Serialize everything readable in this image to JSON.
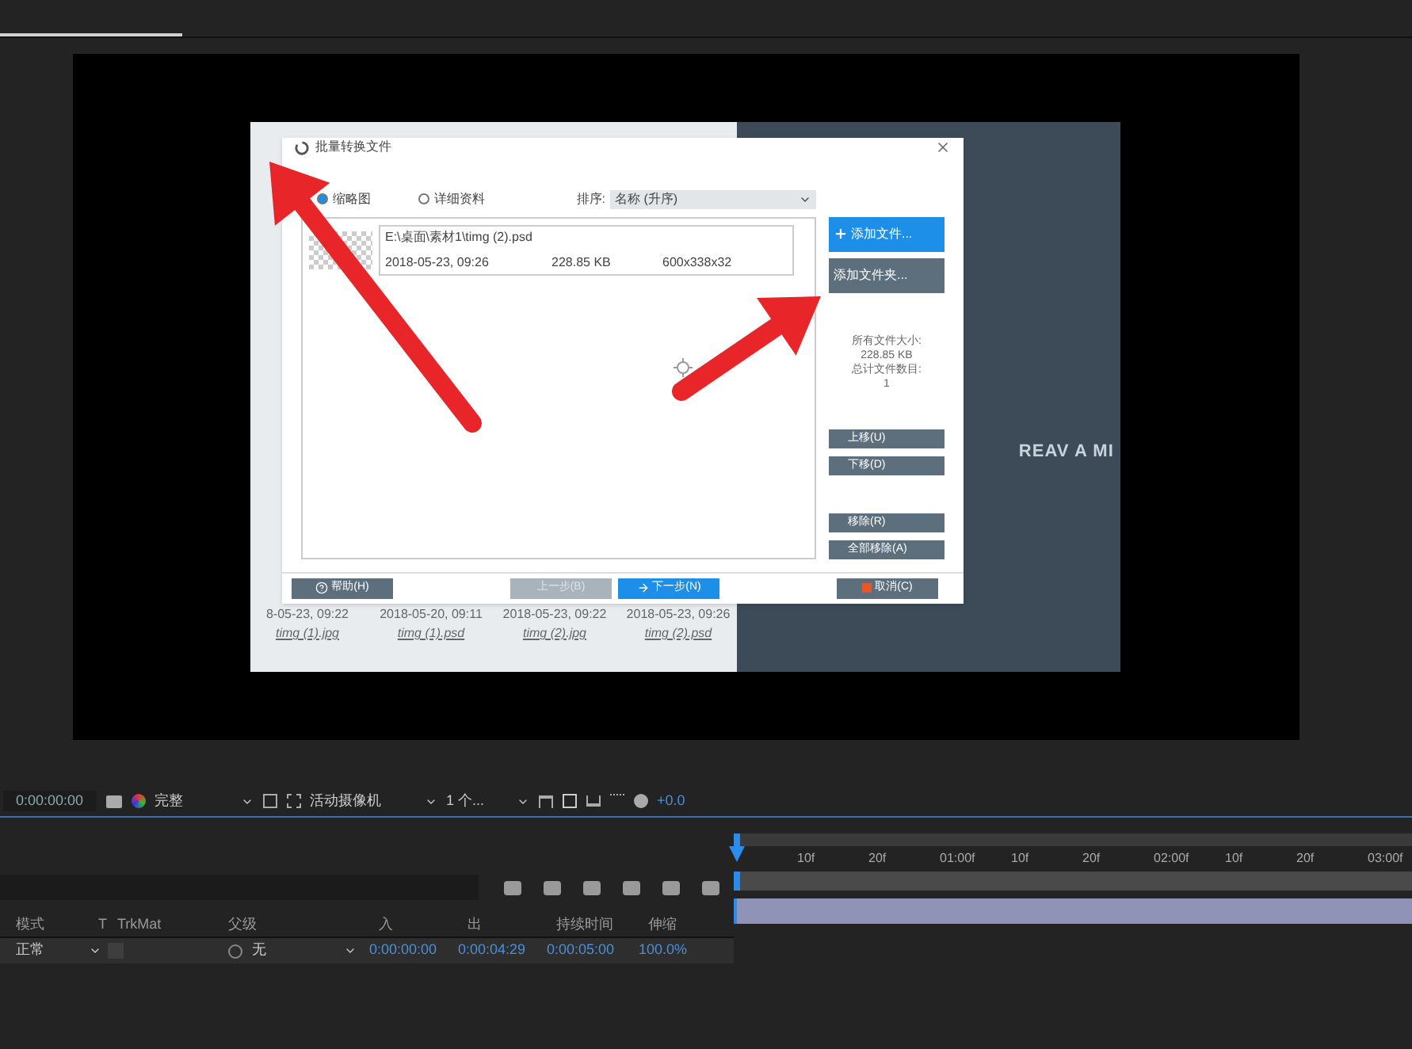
{
  "comp_image": {
    "captions": [
      {
        "date": "8-05-23, 09:22",
        "name": "timg (1).jpg"
      },
      {
        "date": "2018-05-20, 09:11",
        "name": "timg (1).psd"
      },
      {
        "date": "2018-05-23, 09:22",
        "name": "timg (2).jpg"
      },
      {
        "date": "2018-05-23, 09:26",
        "name": "timg (2).psd"
      }
    ],
    "logo_text": "REAV A MI"
  },
  "dialog": {
    "title": "批量转换文件",
    "views": [
      {
        "label": "缩略图",
        "selected": true
      },
      {
        "label": "详细资料",
        "selected": false
      }
    ],
    "sort_label": "排序:",
    "sort_value": "名称 (升序)",
    "file": {
      "path": "E:\\桌面\\素材1\\timg (2).psd",
      "date": "2018-05-23, 09:26",
      "size": "228.85 KB",
      "dims": "600x338x32"
    },
    "side_buttons": [
      {
        "label": "添加文件...",
        "kind": "primary"
      },
      {
        "label": "添加文件夹...",
        "kind": "secondary"
      }
    ],
    "summary": [
      "所有文件大小:",
      "228.85 KB",
      "总计文件数目:",
      "1"
    ],
    "move_buttons": [
      "上移(U)",
      "下移(D)"
    ],
    "remove_buttons": [
      "移除(R)",
      "全部移除(A)"
    ],
    "footer": [
      {
        "label": "帮助(H)",
        "kind": "help"
      },
      {
        "label": "上一步(B)",
        "kind": "disabled"
      },
      {
        "label": "下一步(N)",
        "kind": "primary"
      },
      {
        "label": "取消(C)",
        "kind": "cancel"
      }
    ]
  },
  "viewer_toolbar": {
    "timecode": "0:00:00:00",
    "resolution": "完整",
    "camera": "活动摄像机",
    "views": "1 个...",
    "exposure": "+0.0"
  },
  "timeline": {
    "columns": [
      "模式",
      "T",
      "TrkMat",
      "父级",
      "入",
      "出",
      "持续时间",
      "伸缩"
    ],
    "row": {
      "mode": "正常",
      "parent": "无",
      "in": "0:00:00:00",
      "out": "0:00:04:29",
      "duration": "0:00:05:00",
      "stretch": "100.0%"
    },
    "ruler": [
      "10f",
      "20f",
      "01:00f",
      "10f",
      "20f",
      "02:00f",
      "10f",
      "20f",
      "03:00f"
    ]
  }
}
